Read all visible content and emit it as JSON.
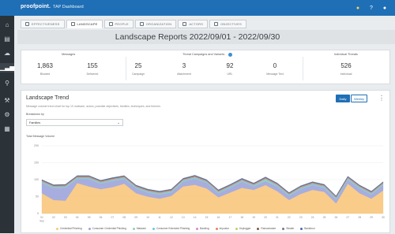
{
  "header": {
    "logo": "proofpoint.",
    "app_title": "TAP Dashboard"
  },
  "sidebar": {
    "items": [
      "home",
      "document",
      "cloud",
      "chart",
      "search",
      "wrench",
      "gear",
      "grid"
    ]
  },
  "tabs": [
    {
      "label": "EFFECTIVENESS"
    },
    {
      "label": "LANDSCAPE"
    },
    {
      "label": "PEOPLE"
    },
    {
      "label": "ORGANIZATION"
    },
    {
      "label": "ACTORS"
    },
    {
      "label": "OBJECTIVES"
    }
  ],
  "page": {
    "title": "Landscape Reports 2022/09/01 - 2022/09/30"
  },
  "stats": {
    "messages_head": "Messages",
    "threats_head": "Threat Campaigns and Variants",
    "individual_head": "Individual Threats",
    "items": [
      {
        "value": "1,863",
        "label": "Blocked"
      },
      {
        "value": "155",
        "label": "Delivered"
      },
      {
        "value": "25",
        "label": "Campaign"
      },
      {
        "value": "3",
        "label": "Attachment"
      },
      {
        "value": "92",
        "label": "URL"
      },
      {
        "value": "0",
        "label": "Message Text"
      },
      {
        "value": "526",
        "label": "Individual"
      }
    ]
  },
  "trend": {
    "title": "Landscape Trend",
    "description": "Message volume trend chart for top 10 malware, actors, possible objectives, families, techniques, and themes.",
    "daily": "Daily",
    "weekly": "Weekly",
    "breakdown_label": "Breakdown by",
    "breakdown_value": "Families",
    "yaxis_title": "Total Message Volume"
  },
  "chart_data": {
    "type": "area",
    "x": [
      "01 Sep",
      "02",
      "03",
      "04",
      "05",
      "06",
      "07",
      "08",
      "09",
      "10",
      "11",
      "12",
      "13",
      "14",
      "15",
      "16",
      "17",
      "18",
      "19",
      "20",
      "21",
      "22",
      "23",
      "24",
      "25",
      "26",
      "27",
      "28",
      "29",
      "30"
    ],
    "yticks": [
      "200",
      "150",
      "100",
      "50",
      "0"
    ],
    "ylim": [
      0,
      200
    ],
    "stacked": true,
    "series": [
      {
        "name": "Credential Phishing",
        "color": "#f8c77c",
        "values": [
          60,
          40,
          38,
          90,
          80,
          72,
          78,
          88,
          60,
          50,
          44,
          52,
          80,
          85,
          74,
          48,
          62,
          76,
          70,
          84,
          66,
          40,
          58,
          70,
          64,
          30,
          88,
          60,
          44,
          68
        ]
      },
      {
        "name": "Consumer Credential Phishing",
        "color": "#9da4dc",
        "values": [
          30,
          35,
          38,
          12,
          22,
          16,
          18,
          14,
          14,
          12,
          12,
          10,
          14,
          18,
          16,
          12,
          14,
          18,
          10,
          12,
          14,
          12,
          14,
          14,
          12,
          12,
          12,
          14,
          12,
          16
        ]
      },
      {
        "name": "Malware",
        "color": "#8ed1b8",
        "values": [
          2,
          2,
          2,
          2,
          2,
          2,
          2,
          2,
          2,
          2,
          2,
          2,
          2,
          2,
          2,
          2,
          2,
          2,
          2,
          4,
          2,
          2,
          2,
          2,
          2,
          2,
          2,
          2,
          2,
          2
        ]
      },
      {
        "name": "Consumer Extended Phishing",
        "color": "#6cc4e6",
        "values": [
          2,
          2,
          2,
          2,
          2,
          2,
          2,
          2,
          2,
          2,
          2,
          2,
          2,
          2,
          2,
          2,
          2,
          2,
          2,
          2,
          2,
          2,
          2,
          2,
          2,
          2,
          2,
          2,
          2,
          2
        ]
      },
      {
        "name": "Banking",
        "color": "#d889c9",
        "values": [
          1,
          1,
          1,
          1,
          1,
          1,
          1,
          1,
          1,
          1,
          1,
          1,
          1,
          1,
          1,
          1,
          1,
          1,
          1,
          1,
          1,
          1,
          1,
          1,
          1,
          1,
          1,
          1,
          1,
          1
        ]
      },
      {
        "name": "Impostor",
        "color": "#e88062",
        "values": [
          1,
          1,
          1,
          1,
          1,
          1,
          1,
          1,
          1,
          1,
          1,
          1,
          1,
          1,
          1,
          1,
          1,
          1,
          1,
          1,
          1,
          1,
          1,
          1,
          1,
          1,
          1,
          1,
          1,
          1
        ]
      },
      {
        "name": "Keylogger",
        "color": "#b8d36b",
        "values": [
          1,
          1,
          1,
          1,
          1,
          1,
          1,
          1,
          1,
          1,
          1,
          1,
          1,
          1,
          1,
          1,
          1,
          1,
          1,
          1,
          1,
          1,
          1,
          1,
          1,
          1,
          1,
          1,
          1,
          1
        ]
      },
      {
        "name": "Ransomware",
        "color": "#7a5c44",
        "values": [
          1,
          1,
          1,
          1,
          1,
          1,
          1,
          1,
          1,
          1,
          1,
          1,
          1,
          1,
          1,
          1,
          1,
          1,
          1,
          1,
          1,
          1,
          1,
          1,
          1,
          1,
          1,
          1,
          1,
          1
        ]
      },
      {
        "name": "Stealer",
        "color": "#6c7b88",
        "values": [
          1,
          1,
          1,
          1,
          1,
          1,
          1,
          1,
          1,
          1,
          1,
          1,
          1,
          1,
          1,
          1,
          1,
          1,
          1,
          1,
          1,
          1,
          1,
          1,
          1,
          1,
          1,
          1,
          1,
          1
        ]
      },
      {
        "name": "Backdoor",
        "color": "#4e66b8",
        "values": [
          1,
          1,
          1,
          1,
          1,
          1,
          1,
          1,
          1,
          1,
          1,
          1,
          1,
          1,
          1,
          1,
          1,
          1,
          1,
          1,
          1,
          1,
          1,
          1,
          1,
          1,
          1,
          1,
          1,
          1
        ]
      }
    ]
  }
}
